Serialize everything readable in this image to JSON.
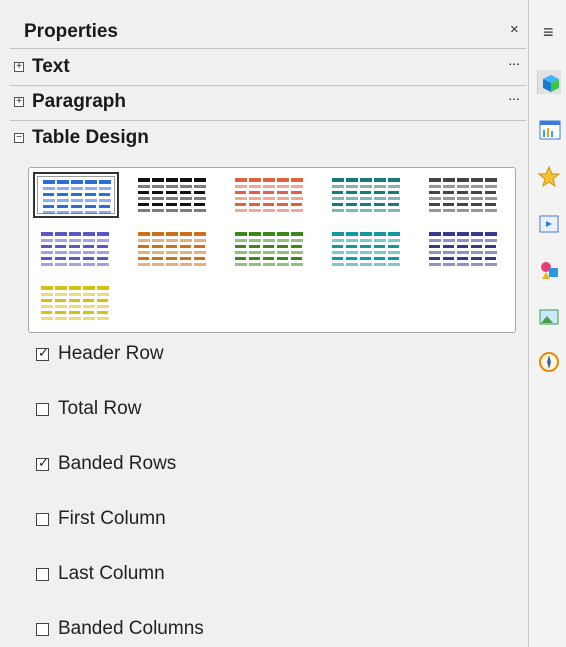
{
  "panel": {
    "title": "Properties",
    "close_glyph": "×"
  },
  "sections": [
    {
      "label": "Text",
      "expanded": false,
      "toggle_glyph": "+",
      "more": "···"
    },
    {
      "label": "Paragraph",
      "expanded": false,
      "toggle_glyph": "+",
      "more": "···"
    },
    {
      "label": "Table Design",
      "expanded": true,
      "toggle_glyph": "−"
    }
  ],
  "table_styles": [
    {
      "name": "default-blue",
      "color": "#2a6ed8",
      "selected": true
    },
    {
      "name": "black",
      "color": "#111111"
    },
    {
      "name": "red",
      "color": "#e06040"
    },
    {
      "name": "teal",
      "color": "#147a7a"
    },
    {
      "name": "gray",
      "color": "#444444"
    },
    {
      "name": "lavender",
      "color": "#5858c8"
    },
    {
      "name": "orange",
      "color": "#d07018"
    },
    {
      "name": "green",
      "color": "#3a8a1a"
    },
    {
      "name": "cyan",
      "color": "#109aa0"
    },
    {
      "name": "indigo",
      "color": "#383890"
    },
    {
      "name": "yellow",
      "color": "#d8c010"
    }
  ],
  "options": [
    {
      "label": "Header Row",
      "checked": true
    },
    {
      "label": "Total Row",
      "checked": false
    },
    {
      "label": "Banded Rows",
      "checked": true
    },
    {
      "label": "First Column",
      "checked": false
    },
    {
      "label": "Last Column",
      "checked": false
    },
    {
      "label": "Banded Columns",
      "checked": false
    }
  ],
  "sidebar": {
    "menu_icon": "hamburger-menu-icon",
    "icons": [
      "properties-cube-icon",
      "styles-chart-icon",
      "gallery-star-icon",
      "navigator-slides-icon",
      "shapes-icon",
      "image-icon",
      "navigator-compass-icon"
    ]
  }
}
